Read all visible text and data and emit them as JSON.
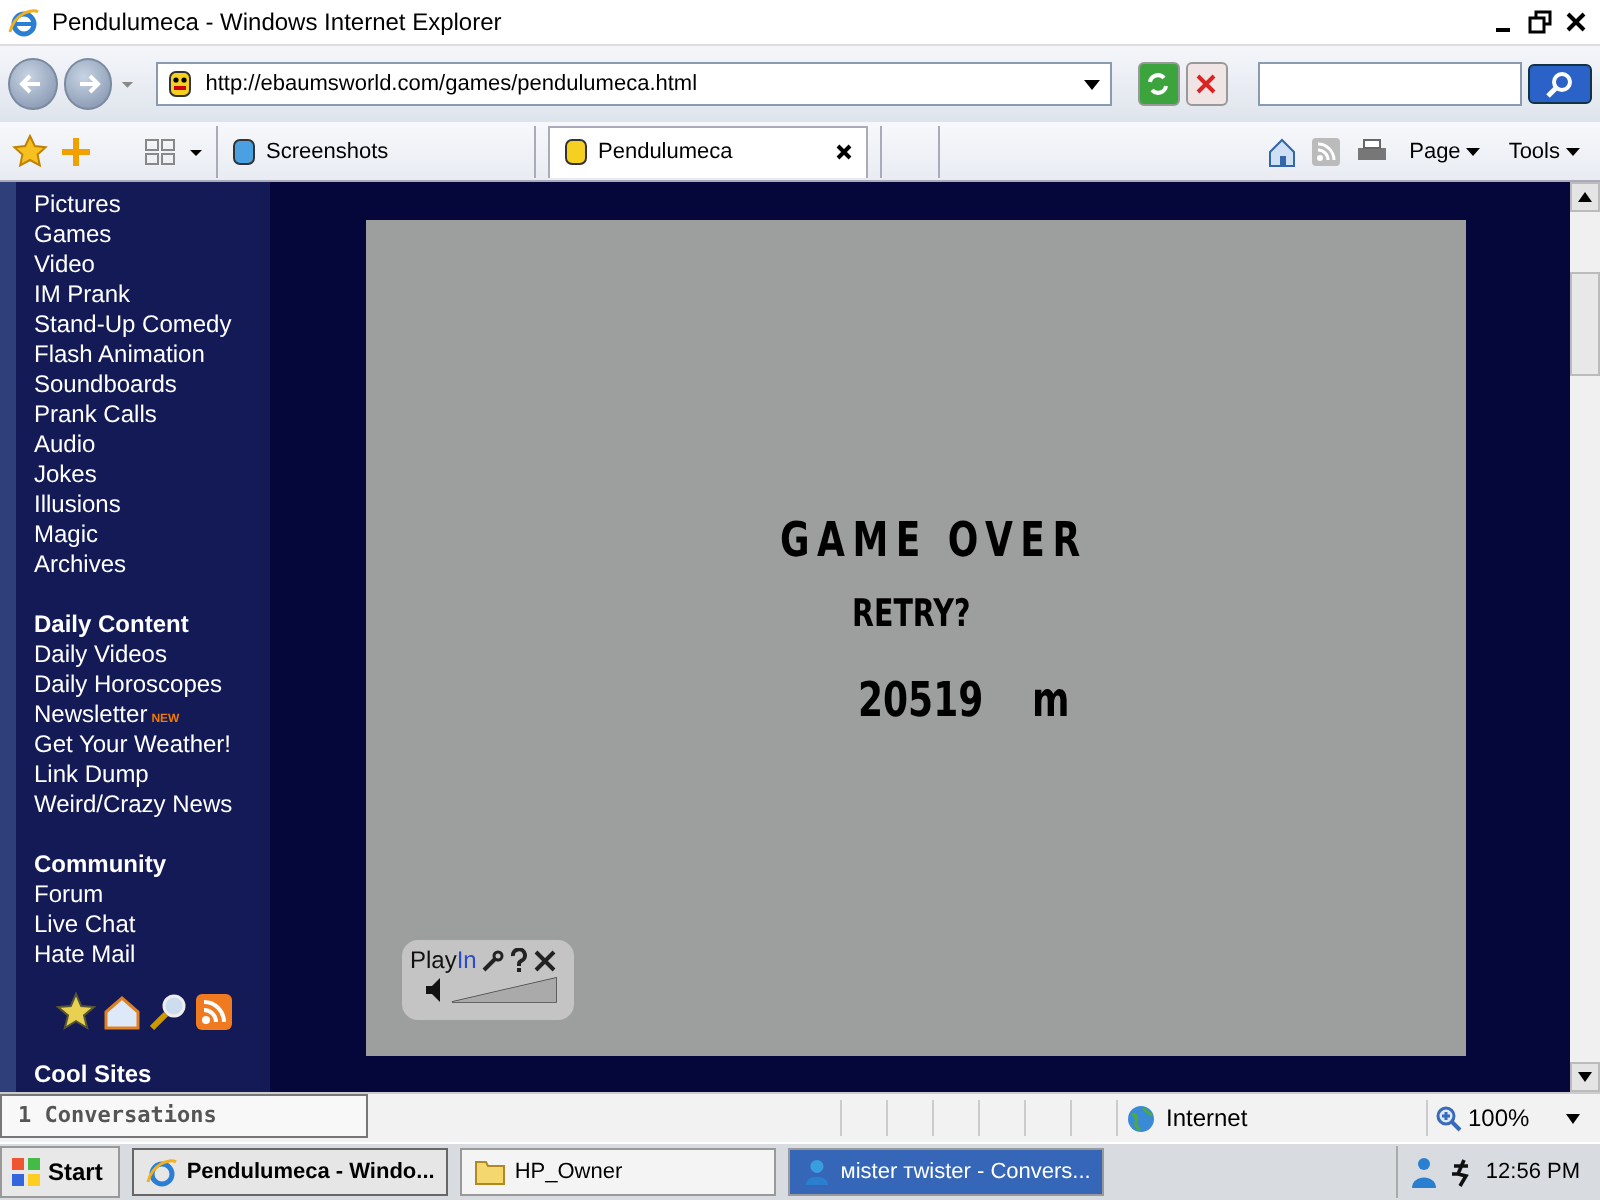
{
  "window": {
    "title": "Pendulumeca - Windows Internet Explorer"
  },
  "address_bar": {
    "url": "http://ebaumsworld.com/games/pendulumeca.html"
  },
  "tabs": [
    {
      "label": "Screenshots",
      "selected": false
    },
    {
      "label": "Pendulumeca",
      "selected": true
    }
  ],
  "command_bar": [
    "Page",
    "Tools"
  ],
  "sidebar": {
    "sections": [
      {
        "items": [
          {
            "label": "Pictures"
          },
          {
            "label": "Games"
          },
          {
            "label": "Video"
          },
          {
            "label": "IM Prank"
          },
          {
            "label": "Stand-Up Comedy"
          },
          {
            "label": "Flash Animation"
          },
          {
            "label": "Soundboards"
          },
          {
            "label": "Prank Calls"
          },
          {
            "label": "Audio"
          },
          {
            "label": "Jokes"
          },
          {
            "label": "Illusions"
          },
          {
            "label": "Magic"
          },
          {
            "label": "Archives"
          }
        ]
      },
      {
        "heading": "Daily Content",
        "items": [
          {
            "label": "Daily Videos"
          },
          {
            "label": "Daily Horoscopes"
          },
          {
            "label": "Newsletter",
            "badge": "NEW"
          },
          {
            "label": "Get Your Weather!"
          },
          {
            "label": "Link Dump"
          },
          {
            "label": "Weird/Crazy News"
          }
        ]
      },
      {
        "heading": "Community",
        "items": [
          {
            "label": "Forum"
          },
          {
            "label": "Live Chat"
          },
          {
            "label": "Hate Mail"
          }
        ]
      }
    ],
    "footer_heading": "Cool Sites"
  },
  "game": {
    "title": "GAME OVER",
    "prompt": "RETRY?",
    "distance": "20519",
    "unit": "m",
    "widget": {
      "label_start": "Play",
      "label_end": "In",
      "volume": {
        "level": 1
      }
    }
  },
  "status_bar": {
    "zone": "Internet",
    "zoom": "100%"
  },
  "conversations_popup": "1 Conversations",
  "taskbar": {
    "start": "Start",
    "buttons": [
      {
        "label": "Pendulumeca - Windo...",
        "selected": true,
        "flashing": false
      },
      {
        "label": "HP_Owner",
        "selected": false,
        "flashing": false
      },
      {
        "label": "мister тwister - Convers...",
        "selected": false,
        "flashing": true
      }
    ],
    "clock": "12:56 PM"
  }
}
